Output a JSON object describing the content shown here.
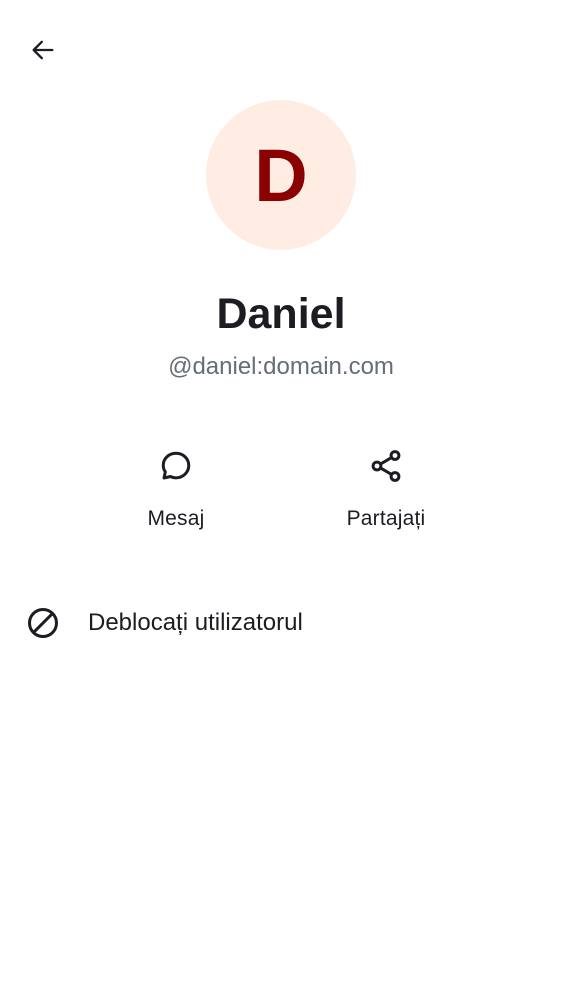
{
  "toolbar": {
    "back_icon": "arrow-left-icon"
  },
  "profile": {
    "avatar_letter": "D",
    "avatar_bg": "#ffede3",
    "avatar_fg": "#8b0000",
    "display_name": "Daniel",
    "user_id": "@daniel:domain.com"
  },
  "actions": [
    {
      "label": "Mesaj",
      "icon": "chat-bubble-icon"
    },
    {
      "label": "Partajați",
      "icon": "share-icon"
    }
  ],
  "options": [
    {
      "label": "Deblocați utilizatorul",
      "icon": "block-icon"
    }
  ],
  "colors": {
    "text_primary": "#1b1d22",
    "text_secondary": "#656d77",
    "background": "#ffffff"
  }
}
